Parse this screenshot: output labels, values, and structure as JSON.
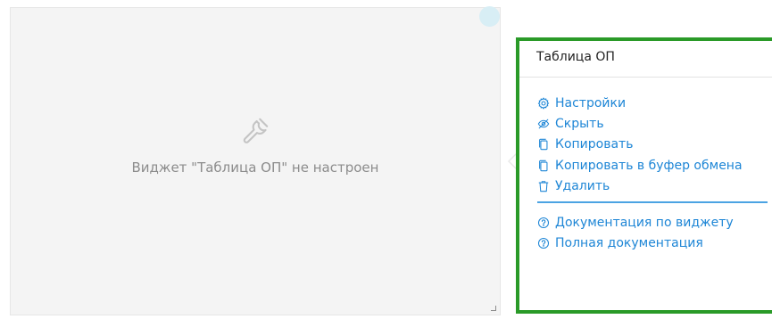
{
  "widget": {
    "message": "Виджет \"Таблица ОП\" не настроен",
    "icon": "wrench-icon"
  },
  "menu": {
    "title": "Таблица ОП",
    "border_color": "#2a9a28",
    "link_color": "#1e86d6",
    "items": [
      {
        "label": "Настройки",
        "icon": "gear-icon"
      },
      {
        "label": "Скрыть",
        "icon": "eye-slash-icon"
      },
      {
        "label": "Копировать",
        "icon": "copy-icon"
      },
      {
        "label": "Копировать в буфер обмена",
        "icon": "copy-icon"
      },
      {
        "label": "Удалить",
        "icon": "trash-icon"
      }
    ],
    "help_items": [
      {
        "label": "Документация по виджету",
        "icon": "question-circle-icon"
      },
      {
        "label": "Полная документация",
        "icon": "question-circle-icon"
      }
    ]
  }
}
